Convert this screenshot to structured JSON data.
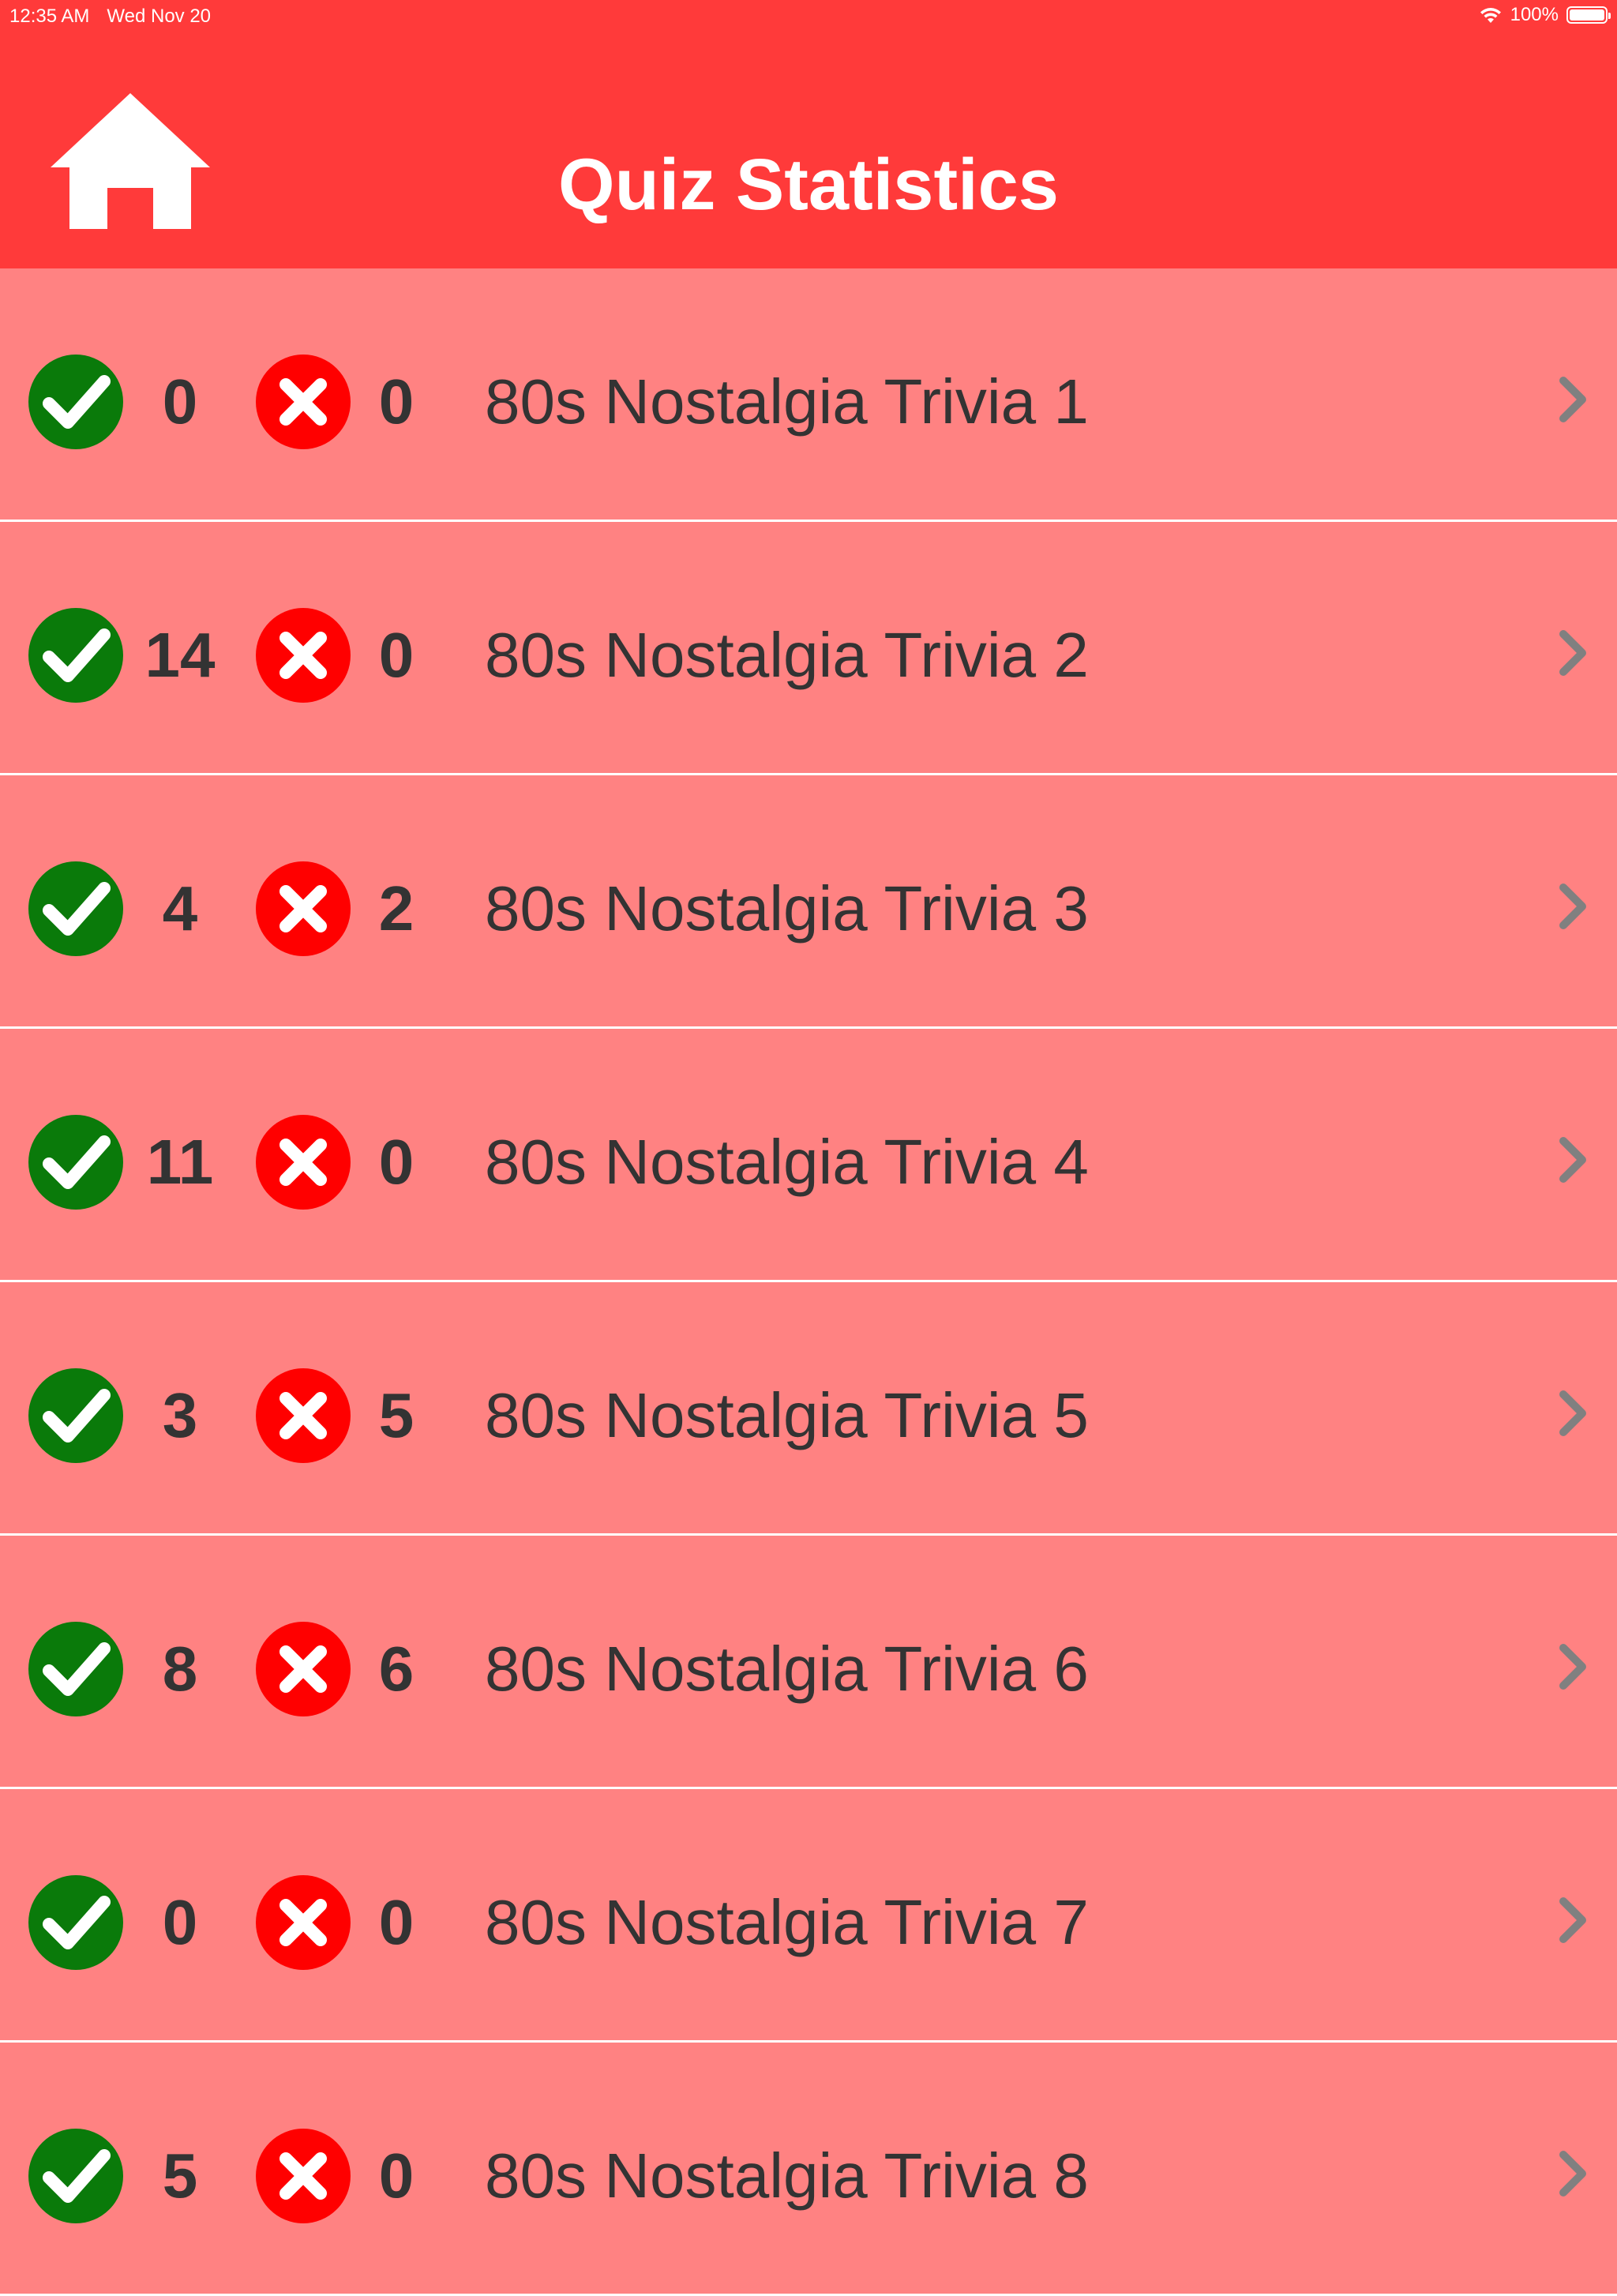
{
  "status_bar": {
    "time": "12:35 AM",
    "date": "Wed Nov 20",
    "battery_text": "100%",
    "icons": [
      "wifi-icon",
      "battery-icon"
    ]
  },
  "header": {
    "title": "Quiz Statistics",
    "home_icon": "home-icon"
  },
  "colors": {
    "header_bg": "#FF3A3A",
    "list_bg": "#FF8282",
    "correct": "#0A7A0A",
    "wrong": "#FF0000",
    "text": "#333333",
    "chevron": "#808080"
  },
  "quizzes": [
    {
      "correct": "0",
      "wrong": "0",
      "name": "80s Nostalgia Trivia 1"
    },
    {
      "correct": "14",
      "wrong": "0",
      "name": "80s Nostalgia Trivia 2"
    },
    {
      "correct": "4",
      "wrong": "2",
      "name": "80s Nostalgia Trivia 3"
    },
    {
      "correct": "11",
      "wrong": "0",
      "name": "80s Nostalgia Trivia 4"
    },
    {
      "correct": "3",
      "wrong": "5",
      "name": "80s Nostalgia Trivia 5"
    },
    {
      "correct": "8",
      "wrong": "6",
      "name": "80s Nostalgia Trivia 6"
    },
    {
      "correct": "0",
      "wrong": "0",
      "name": "80s Nostalgia Trivia 7"
    },
    {
      "correct": "5",
      "wrong": "0",
      "name": "80s Nostalgia Trivia 8"
    }
  ]
}
